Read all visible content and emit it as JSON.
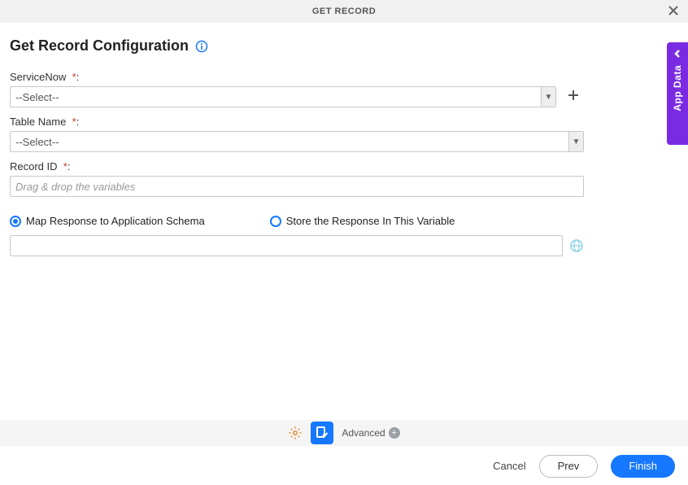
{
  "header": {
    "title": "GET RECORD"
  },
  "page": {
    "title": "Get Record Configuration"
  },
  "fields": {
    "serviceNow": {
      "label": "ServiceNow",
      "required": "*",
      "colon": ":",
      "value": "--Select--"
    },
    "tableName": {
      "label": "Table Name",
      "required": "*",
      "colon": ":",
      "value": "--Select--"
    },
    "recordId": {
      "label": "Record ID",
      "required": "*",
      "colon": ":",
      "placeholder": "Drag & drop the variables"
    }
  },
  "responseOptions": {
    "mapToSchema": {
      "label": "Map Response to Application Schema",
      "selected": true
    },
    "storeInVar": {
      "label": "Store the Response In This Variable",
      "selected": false
    }
  },
  "toolbar": {
    "advanced_label": "Advanced"
  },
  "sideTab": {
    "label": "App Data"
  },
  "footer": {
    "cancel_label": "Cancel",
    "prev_label": "Prev",
    "finish_label": "Finish"
  }
}
